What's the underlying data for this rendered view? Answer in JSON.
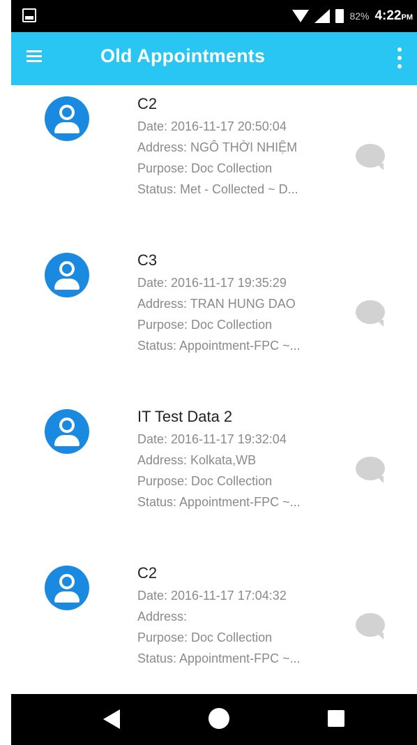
{
  "status_bar": {
    "battery": "82%",
    "time": "4:22",
    "ampm": "PM"
  },
  "app_bar": {
    "title": "Old Appointments"
  },
  "appointments": [
    {
      "name": "C2",
      "date": "Date: 2016-11-17 20:50:04",
      "address": "Address: NGÔ THỜI NHIỆM",
      "purpose": "Purpose: Doc Collection",
      "status": "Status: Met - Collected ~ D..."
    },
    {
      "name": "C3",
      "date": "Date: 2016-11-17 19:35:29",
      "address": "Address: TRAN HUNG DAO",
      "purpose": "Purpose: Doc Collection",
      "status": "Status: Appointment-FPC ~..."
    },
    {
      "name": "IT Test Data 2",
      "date": "Date: 2016-11-17 19:32:04",
      "address": "Address: Kolkata,WB",
      "purpose": "Purpose: Doc Collection",
      "status": "Status: Appointment-FPC ~..."
    },
    {
      "name": "C2",
      "date": "Date: 2016-11-17 17:04:32",
      "address": "Address:",
      "purpose": "Purpose: Doc Collection",
      "status": "Status: Appointment-FPC ~..."
    }
  ],
  "icons": {
    "menu": "menu-icon",
    "more": "more-vert-icon",
    "avatar": "person-icon",
    "chat": "chat-bubble-icon"
  },
  "colors": {
    "app_bar": "#29c6f3",
    "avatar": "#1a8ae0",
    "chat_icon": "#d2d2d2"
  }
}
